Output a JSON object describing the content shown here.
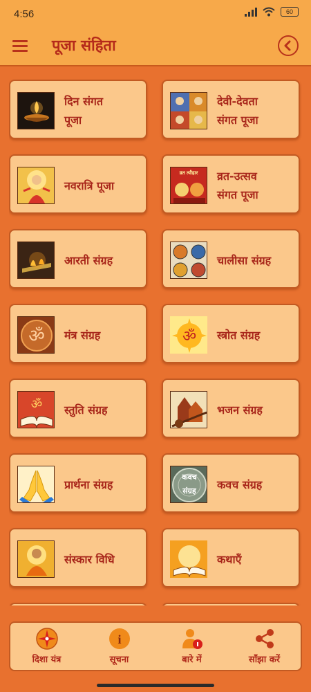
{
  "status_bar": {
    "time": "4:56",
    "battery": "60"
  },
  "app_bar": {
    "title": "पूजा संहिता"
  },
  "cards": [
    {
      "line1": "दिन संगत",
      "line2": "पूजा",
      "icon": "diya-lamp-icon"
    },
    {
      "line1": "देवी-देवता",
      "line2": "संगत पूजा",
      "icon": "deities-icon"
    },
    {
      "line1": "नवरात्रि पूजा",
      "line2": "",
      "icon": "goddess-icon"
    },
    {
      "line1": "व्रत-उत्सव",
      "line2": "संगत पूजा",
      "icon": "vrat-book-icon"
    },
    {
      "line1": "आरती संग्रह",
      "line2": "",
      "icon": "aarti-flame-icon"
    },
    {
      "line1": "चालीसा संग्रह",
      "line2": "",
      "icon": "chalisa-icon"
    },
    {
      "line1": "मंत्र संग्रह",
      "line2": "",
      "icon": "om-bronze-icon"
    },
    {
      "line1": "स्त्रोत संग्रह",
      "line2": "",
      "icon": "om-sun-icon"
    },
    {
      "line1": "स्तुति संग्रह",
      "line2": "",
      "icon": "om-book-icon"
    },
    {
      "line1": "भजन संग्रह",
      "line2": "",
      "icon": "temple-veena-icon"
    },
    {
      "line1": "प्रार्थना संग्रह",
      "line2": "",
      "icon": "praying-hands-icon"
    },
    {
      "line1": "कवच संग्रह",
      "line2": "",
      "icon": "kavach-icon"
    },
    {
      "line1": "संस्कार विधि",
      "line2": "",
      "icon": "sage-icon"
    },
    {
      "line1": "कथाएँ",
      "line2": "",
      "icon": "glowing-book-icon"
    }
  ],
  "thumb_texts": {
    "vrat": "व्रत त्यौहार",
    "kavach_top": "कवच",
    "kavach_bottom": "संग्रह"
  },
  "bottom_nav": [
    {
      "label": "दिशा यंत्र",
      "icon": "compass-icon"
    },
    {
      "label": "सूचना",
      "icon": "info-icon"
    },
    {
      "label": "बारे में",
      "icon": "user-info-icon"
    },
    {
      "label": "साँझा करें",
      "icon": "share-icon"
    }
  ],
  "colors": {
    "background": "#e8712f",
    "app_bar": "#f7a94a",
    "card": "#fbc88b",
    "accent_text": "#a8261a"
  }
}
